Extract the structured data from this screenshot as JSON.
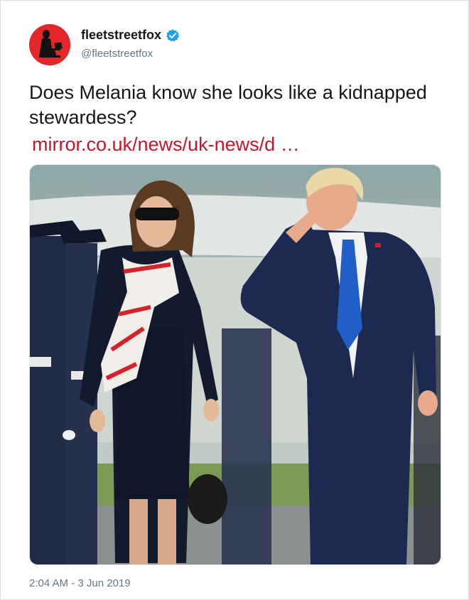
{
  "tweet": {
    "display_name": "fleetstreetfox",
    "handle": "@fleetstreetfox",
    "verified_icon": "verified-badge-icon",
    "text": "Does Melania know she looks like a kidnapped stewardess?",
    "link_text": "mirror.co.uk/news/uk-news/d …",
    "timestamp": "2:04 AM - 3 Jun 2019"
  },
  "colors": {
    "avatar_bg": "#e3262b",
    "link": "#c8152b",
    "verified": "#1da1f2",
    "secondary_text": "#657786"
  }
}
